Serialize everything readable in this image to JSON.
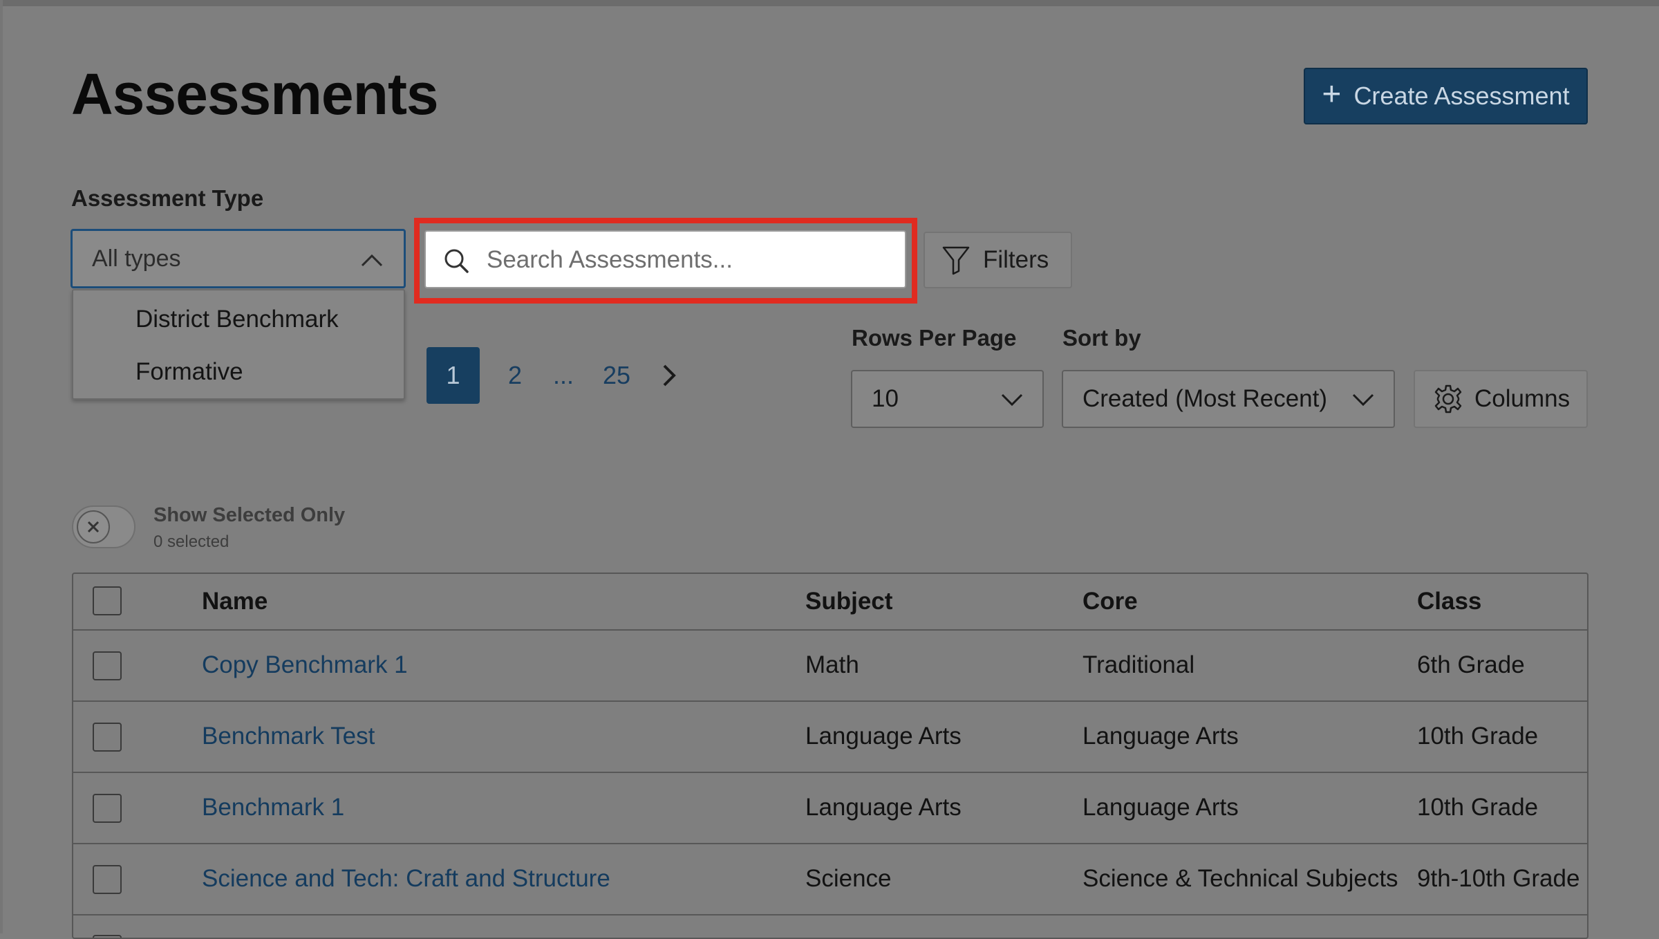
{
  "page": {
    "title": "Assessments",
    "create_button_label": "Create Assessment"
  },
  "filters": {
    "assessment_type_label": "Assessment Type",
    "assessment_type_value": "All types",
    "assessment_type_options": [
      "District Benchmark",
      "Formative"
    ],
    "search_placeholder": "Search Assessments...",
    "filters_button_label": "Filters"
  },
  "pagination": {
    "current_page": "1",
    "pages": [
      "1",
      "2",
      "...",
      "25"
    ],
    "next_icon": "chevron-right-icon"
  },
  "controls": {
    "rows_per_page_label": "Rows Per Page",
    "rows_per_page_value": "10",
    "sort_by_label": "Sort by",
    "sort_by_value": "Created (Most Recent)",
    "columns_button_label": "Columns"
  },
  "selection": {
    "toggle_label": "Show Selected Only",
    "selected_count_text": "0 selected",
    "toggle_on": false
  },
  "table": {
    "headers": [
      "Name",
      "Subject",
      "Core",
      "Class"
    ],
    "rows": [
      {
        "name": "Copy Benchmark 1",
        "subject": "Math",
        "core": "Traditional",
        "class": "6th Grade"
      },
      {
        "name": "Benchmark Test",
        "subject": "Language Arts",
        "core": "Language Arts",
        "class": "10th Grade"
      },
      {
        "name": "Benchmark 1",
        "subject": "Language Arts",
        "core": "Language Arts",
        "class": "10th Grade"
      },
      {
        "name": "Science and Tech: Craft and Structure",
        "subject": "Science",
        "core": "Science & Technical Subjects",
        "class": "9th-10th Grade"
      }
    ]
  },
  "colors": {
    "primary": "#173f60",
    "link": "#143b5e",
    "highlight": "#e02b20"
  }
}
